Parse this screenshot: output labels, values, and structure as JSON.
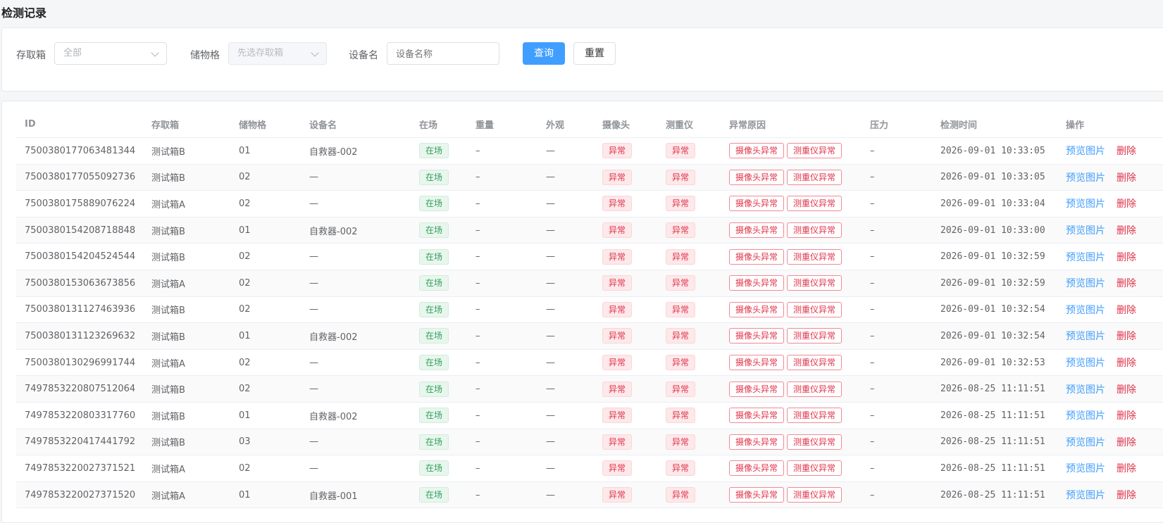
{
  "page": {
    "title": "检测记录"
  },
  "filters": {
    "box_label": "存取箱",
    "box_value": "全部",
    "slot_label": "储物格",
    "slot_placeholder": "先选存取箱",
    "device_label": "设备名",
    "device_placeholder": "设备名称",
    "query_button": "查询",
    "reset_button": "重置"
  },
  "colors": {
    "primary": "#409eff",
    "success": "#2f9e5a",
    "danger": "#e0334a"
  },
  "table": {
    "columns": [
      "ID",
      "存取箱",
      "储物格",
      "设备名",
      "在场",
      "重量",
      "外观",
      "摄像头",
      "测重仪",
      "异常原因",
      "压力",
      "检测时间",
      "操作"
    ],
    "rows": [
      {
        "id": "7500380177063481344",
        "box": "测试箱B",
        "slot": "01",
        "device": "自救器-002",
        "present": "在场",
        "weight": "–",
        "appearance": "—",
        "camera": "异常",
        "scale": "异常",
        "reasons": [
          "摄像头异常",
          "测重仪异常"
        ],
        "pressure": "–",
        "time": "2026-09-01 10:33:05",
        "preview": "预览图片",
        "delete": "删除"
      },
      {
        "id": "7500380177055092736",
        "box": "测试箱B",
        "slot": "02",
        "device": "—",
        "present": "在场",
        "weight": "–",
        "appearance": "—",
        "camera": "异常",
        "scale": "异常",
        "reasons": [
          "摄像头异常",
          "测重仪异常"
        ],
        "pressure": "–",
        "time": "2026-09-01 10:33:05",
        "preview": "预览图片",
        "delete": "删除"
      },
      {
        "id": "7500380175889076224",
        "box": "测试箱A",
        "slot": "02",
        "device": "—",
        "present": "在场",
        "weight": "–",
        "appearance": "—",
        "camera": "异常",
        "scale": "异常",
        "reasons": [
          "摄像头异常",
          "测重仪异常"
        ],
        "pressure": "–",
        "time": "2026-09-01 10:33:04",
        "preview": "预览图片",
        "delete": "删除"
      },
      {
        "id": "7500380154208718848",
        "box": "测试箱B",
        "slot": "01",
        "device": "自救器-002",
        "present": "在场",
        "weight": "–",
        "appearance": "—",
        "camera": "异常",
        "scale": "异常",
        "reasons": [
          "摄像头异常",
          "测重仪异常"
        ],
        "pressure": "–",
        "time": "2026-09-01 10:33:00",
        "preview": "预览图片",
        "delete": "删除"
      },
      {
        "id": "7500380154204524544",
        "box": "测试箱B",
        "slot": "02",
        "device": "—",
        "present": "在场",
        "weight": "–",
        "appearance": "—",
        "camera": "异常",
        "scale": "异常",
        "reasons": [
          "摄像头异常",
          "测重仪异常"
        ],
        "pressure": "–",
        "time": "2026-09-01 10:32:59",
        "preview": "预览图片",
        "delete": "删除"
      },
      {
        "id": "7500380153063673856",
        "box": "测试箱A",
        "slot": "02",
        "device": "—",
        "present": "在场",
        "weight": "–",
        "appearance": "—",
        "camera": "异常",
        "scale": "异常",
        "reasons": [
          "摄像头异常",
          "测重仪异常"
        ],
        "pressure": "–",
        "time": "2026-09-01 10:32:59",
        "preview": "预览图片",
        "delete": "删除"
      },
      {
        "id": "7500380131127463936",
        "box": "测试箱B",
        "slot": "02",
        "device": "—",
        "present": "在场",
        "weight": "–",
        "appearance": "—",
        "camera": "异常",
        "scale": "异常",
        "reasons": [
          "摄像头异常",
          "测重仪异常"
        ],
        "pressure": "–",
        "time": "2026-09-01 10:32:54",
        "preview": "预览图片",
        "delete": "删除"
      },
      {
        "id": "7500380131123269632",
        "box": "测试箱B",
        "slot": "01",
        "device": "自救器-002",
        "present": "在场",
        "weight": "–",
        "appearance": "—",
        "camera": "异常",
        "scale": "异常",
        "reasons": [
          "摄像头异常",
          "测重仪异常"
        ],
        "pressure": "–",
        "time": "2026-09-01 10:32:54",
        "preview": "预览图片",
        "delete": "删除"
      },
      {
        "id": "7500380130296991744",
        "box": "测试箱A",
        "slot": "02",
        "device": "—",
        "present": "在场",
        "weight": "–",
        "appearance": "—",
        "camera": "异常",
        "scale": "异常",
        "reasons": [
          "摄像头异常",
          "测重仪异常"
        ],
        "pressure": "–",
        "time": "2026-09-01 10:32:53",
        "preview": "预览图片",
        "delete": "删除"
      },
      {
        "id": "7497853220807512064",
        "box": "测试箱B",
        "slot": "02",
        "device": "—",
        "present": "在场",
        "weight": "–",
        "appearance": "—",
        "camera": "异常",
        "scale": "异常",
        "reasons": [
          "摄像头异常",
          "测重仪异常"
        ],
        "pressure": "–",
        "time": "2026-08-25 11:11:51",
        "preview": "预览图片",
        "delete": "删除"
      },
      {
        "id": "7497853220803317760",
        "box": "测试箱B",
        "slot": "01",
        "device": "自救器-002",
        "present": "在场",
        "weight": "–",
        "appearance": "—",
        "camera": "异常",
        "scale": "异常",
        "reasons": [
          "摄像头异常",
          "测重仪异常"
        ],
        "pressure": "–",
        "time": "2026-08-25 11:11:51",
        "preview": "预览图片",
        "delete": "删除"
      },
      {
        "id": "7497853220417441792",
        "box": "测试箱B",
        "slot": "03",
        "device": "—",
        "present": "在场",
        "weight": "–",
        "appearance": "—",
        "camera": "异常",
        "scale": "异常",
        "reasons": [
          "摄像头异常",
          "测重仪异常"
        ],
        "pressure": "–",
        "time": "2026-08-25 11:11:51",
        "preview": "预览图片",
        "delete": "删除"
      },
      {
        "id": "7497853220027371521",
        "box": "测试箱A",
        "slot": "02",
        "device": "—",
        "present": "在场",
        "weight": "–",
        "appearance": "—",
        "camera": "异常",
        "scale": "异常",
        "reasons": [
          "摄像头异常",
          "测重仪异常"
        ],
        "pressure": "–",
        "time": "2026-08-25 11:11:51",
        "preview": "预览图片",
        "delete": "删除"
      },
      {
        "id": "7497853220027371520",
        "box": "测试箱A",
        "slot": "01",
        "device": "自救器-001",
        "present": "在场",
        "weight": "–",
        "appearance": "—",
        "camera": "异常",
        "scale": "异常",
        "reasons": [
          "摄像头异常",
          "测重仪异常"
        ],
        "pressure": "–",
        "time": "2026-08-25 11:11:51",
        "preview": "预览图片",
        "delete": "删除"
      }
    ]
  }
}
